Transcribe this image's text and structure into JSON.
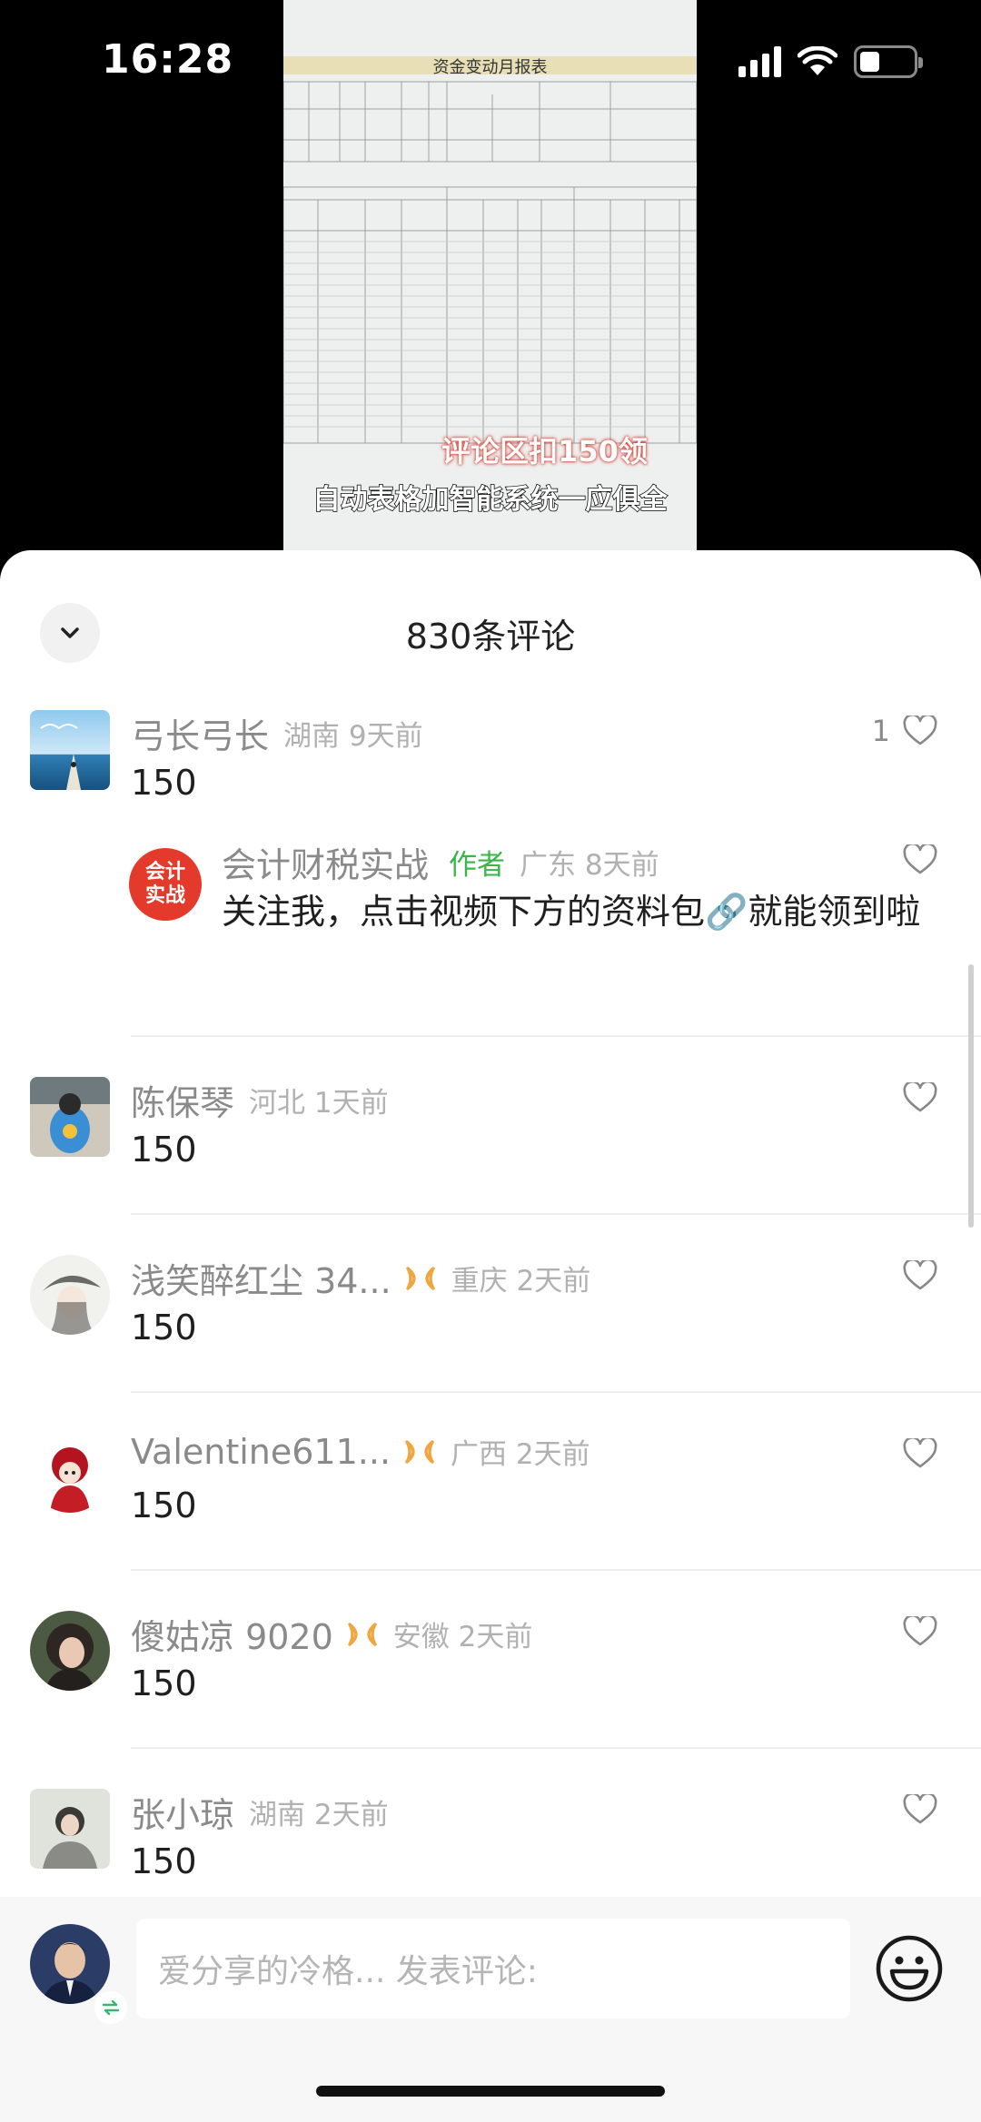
{
  "status_bar": {
    "time": "16:28",
    "battery_level": 0.38
  },
  "video": {
    "sheet_title": "资金变动月报表",
    "caption_1": "评论区扣150领",
    "caption_2": "自动表格加智能系统一应俱全"
  },
  "comments_header": {
    "title": "830条评论"
  },
  "comments": [
    {
      "name": "弓长弓长",
      "badge": "",
      "location_time": "湖南 9天前",
      "text": "150",
      "likes": "1"
    },
    {
      "name": "会计财税实战",
      "badge": "作者",
      "location_time": "广东 8天前",
      "text": "关注我，点击视频下方的资料包🔗就能领到啦",
      "likes": "",
      "avatar_text": "会计\n实战"
    },
    {
      "name": "陈保琴",
      "badge": "",
      "location_time": "河北 1天前",
      "text": "150",
      "likes": ""
    },
    {
      "name": "浅笑醉红尘 34...",
      "badge": "",
      "location_time": "重庆 2天前",
      "text": "150",
      "likes": ""
    },
    {
      "name": "Valentine611...",
      "badge": "",
      "location_time": "广西 2天前",
      "text": "150",
      "likes": ""
    },
    {
      "name": "傻姑凉 9020",
      "badge": "",
      "location_time": "安徽 2天前",
      "text": "150",
      "likes": ""
    },
    {
      "name": "张小琼",
      "badge": "",
      "location_time": "湖南 2天前",
      "text": "150",
      "likes": ""
    }
  ],
  "input_bar": {
    "placeholder": "爱分享的冷格... 发表评论:"
  },
  "colors": {
    "author_badge": "#39b54a",
    "vip_icon": "#f0a640",
    "sheet_bg": "#ffffff",
    "input_bg": "#f7f7f7"
  },
  "icons": [
    "chevron-down-icon",
    "heart-icon",
    "vip-bow-icon",
    "emoji-icon",
    "switch-account-icon",
    "signal-icon",
    "wifi-icon",
    "battery-icon"
  ]
}
